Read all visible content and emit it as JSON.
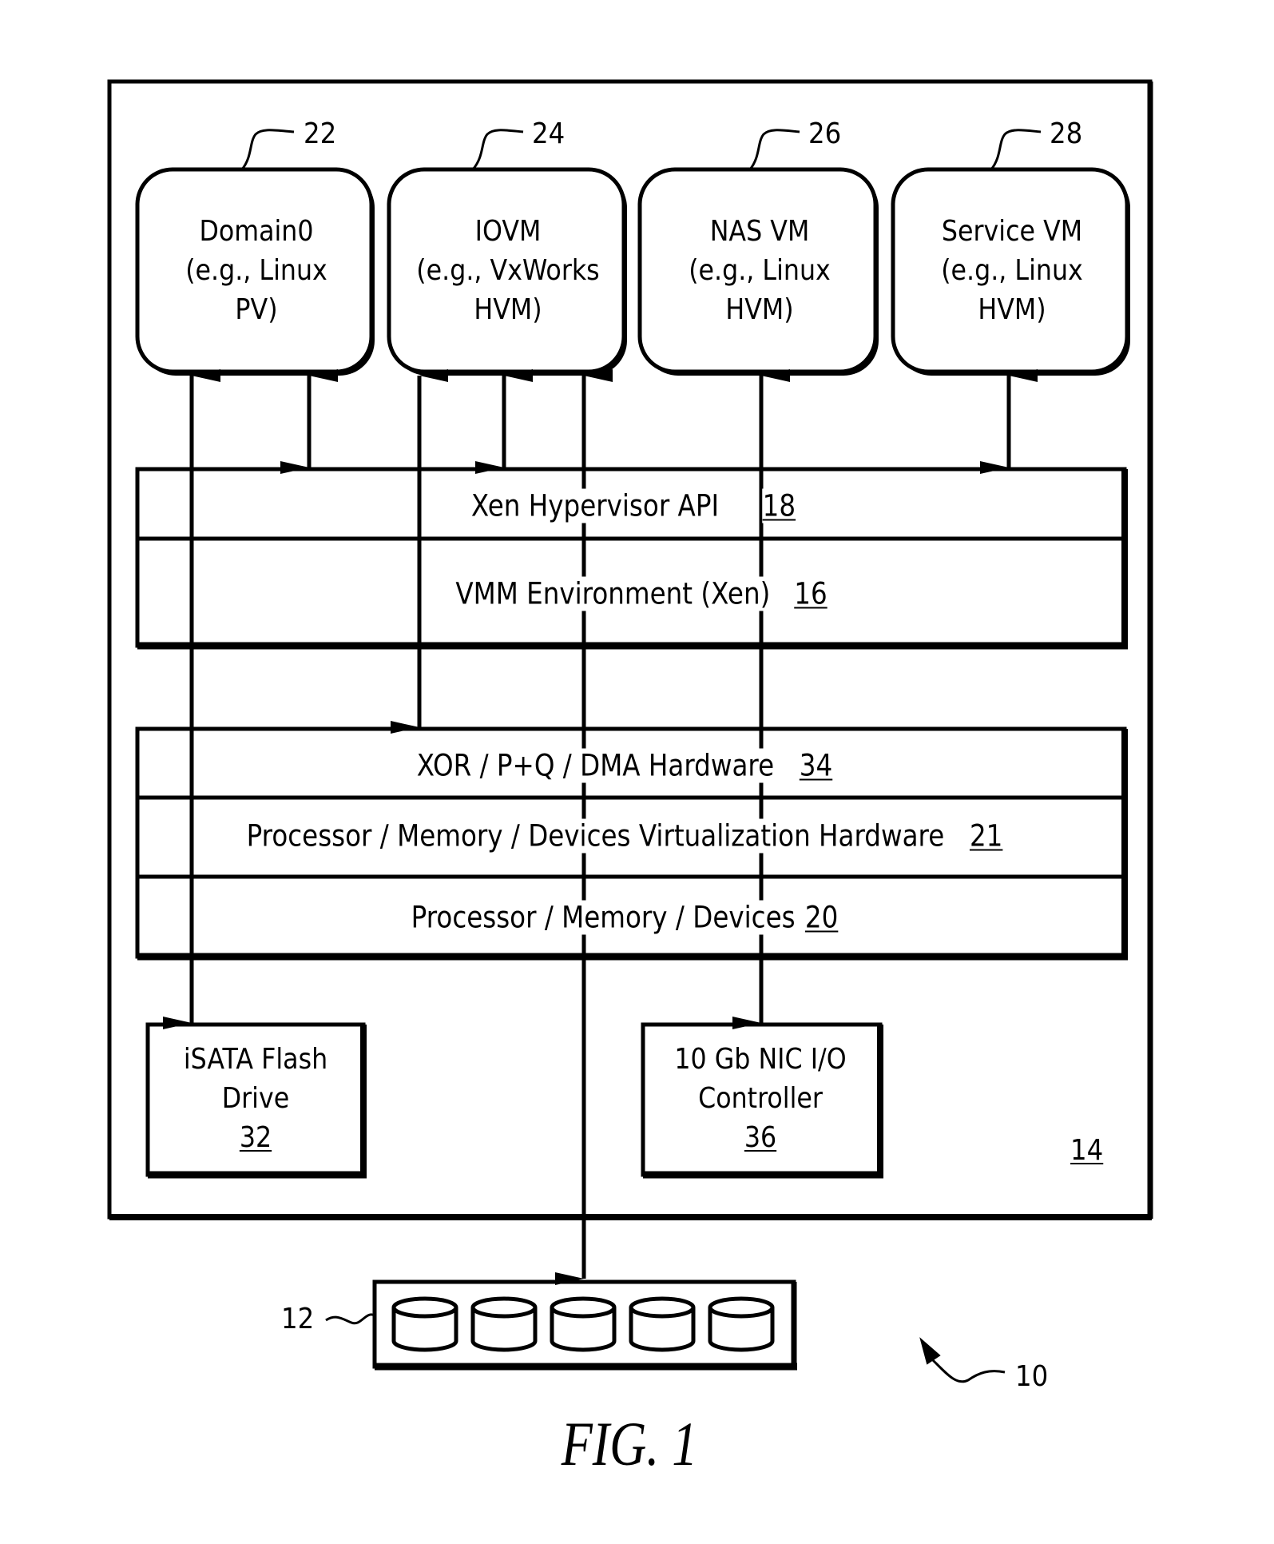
{
  "figure": {
    "caption": "FIG. 1",
    "system_ref": "10",
    "enclosure_ref": "14"
  },
  "vms": [
    {
      "ref": "22",
      "lines": [
        "Domain0",
        "(e.g., Linux",
        "PV)"
      ]
    },
    {
      "ref": "24",
      "lines": [
        "IOVM",
        "(e.g., VxWorks",
        "HVM)"
      ]
    },
    {
      "ref": "26",
      "lines": [
        "NAS VM",
        "(e.g., Linux",
        "HVM)"
      ]
    },
    {
      "ref": "28",
      "lines": [
        "Service VM",
        "(e.g., Linux",
        "HVM)"
      ]
    }
  ],
  "layers": {
    "hypervisor_api": {
      "label": "Xen Hypervisor API",
      "ref": "18"
    },
    "vmm": {
      "label": "VMM Environment (Xen)",
      "ref": "16"
    },
    "xor_hw": {
      "label": "XOR / P+Q / DMA Hardware",
      "ref": "34"
    },
    "virt_hw": {
      "label": "Processor / Memory / Devices Virtualization Hardware",
      "ref": "21"
    },
    "pmd": {
      "label": "Processor / Memory / Devices",
      "ref": "20"
    }
  },
  "devices": {
    "flash": {
      "lines": [
        "iSATA Flash",
        "Drive"
      ],
      "ref": "32"
    },
    "nic": {
      "lines": [
        "10 Gb NIC I/O",
        "Controller"
      ],
      "ref": "36"
    }
  },
  "storage": {
    "ref": "12",
    "disk_count": 5
  }
}
